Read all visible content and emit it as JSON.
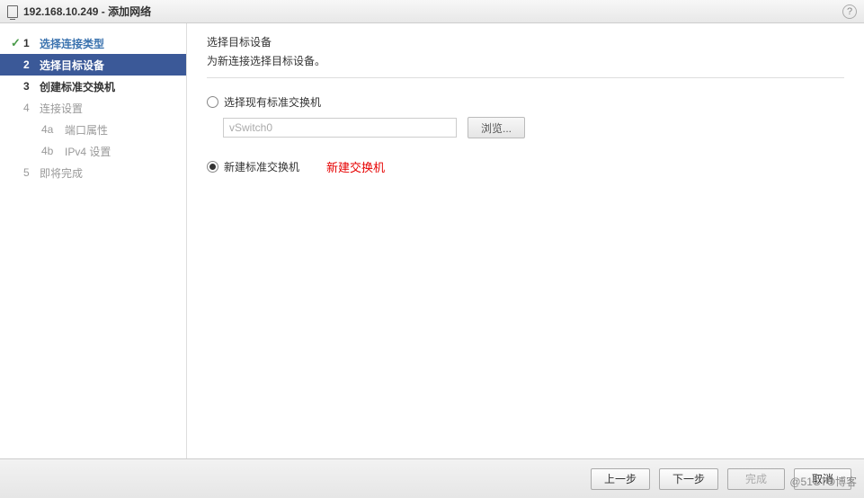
{
  "title": "192.168.10.249 - 添加网络",
  "help_glyph": "?",
  "sidebar": {
    "steps": [
      {
        "num": "1",
        "label": "选择连接类型",
        "state": "done"
      },
      {
        "num": "2",
        "label": "选择目标设备",
        "state": "active"
      },
      {
        "num": "3",
        "label": "创建标准交换机",
        "state": "future"
      },
      {
        "num": "4",
        "label": "连接设置",
        "state": "disabled"
      },
      {
        "num": "5",
        "label": "即将完成",
        "state": "disabled"
      }
    ],
    "substeps": [
      {
        "num": "4a",
        "label": "端口属性"
      },
      {
        "num": "4b",
        "label": "IPv4 设置"
      }
    ]
  },
  "content": {
    "title": "选择目标设备",
    "desc": "为新连接选择目标设备。",
    "option_existing": {
      "label": "选择现有标准交换机",
      "selected": false,
      "input_value": "vSwitch0",
      "browse": "浏览..."
    },
    "option_new": {
      "label": "新建标准交换机",
      "selected": true,
      "annotation": "新建交换机"
    }
  },
  "footer": {
    "back": "上一步",
    "next": "下一步",
    "finish": "完成",
    "cancel": "取消"
  },
  "watermark": "@51CTO博客"
}
